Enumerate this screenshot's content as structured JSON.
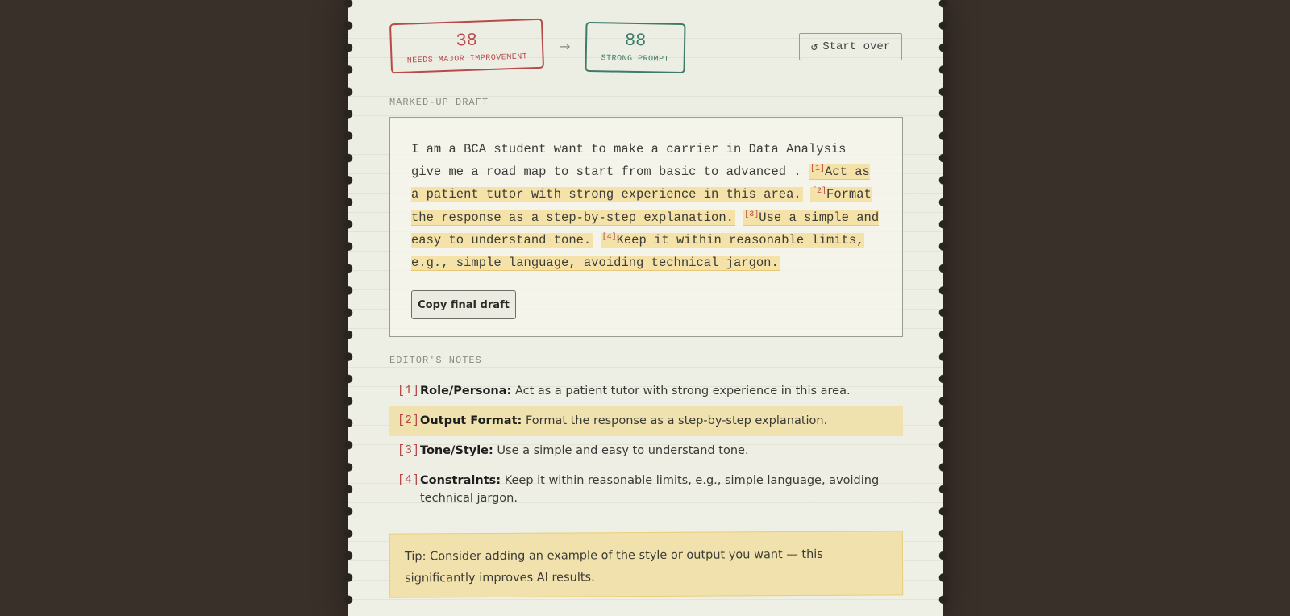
{
  "scores": {
    "before": {
      "value": "38",
      "label": "NEEDS MAJOR IMPROVEMENT"
    },
    "after": {
      "value": "88",
      "label": "STRONG PROMPT"
    },
    "arrow": "→"
  },
  "actions": {
    "start_over_icon": "↺",
    "start_over_label": "Start over",
    "copy_label": "Copy final draft"
  },
  "draft": {
    "section_label": "MARKED-UP DRAFT",
    "original_text": "I am a BCA student want to make a carrier in Data Analysis give me a road map to start from basic to advanced .",
    "additions": [
      {
        "marker": "[1]",
        "text": "Act as a patient tutor with strong experience in this area."
      },
      {
        "marker": "[2]",
        "text": "Format the response as a step-by-step explanation."
      },
      {
        "marker": "[3]",
        "text": "Use a simple and easy to understand tone."
      },
      {
        "marker": "[4]",
        "text": "Keep it within reasonable limits, e.g., simple language, avoiding technical jargon."
      }
    ]
  },
  "notes": {
    "section_label": "EDITOR'S NOTES",
    "items": [
      {
        "num": "[1]",
        "title": "Role/Persona:",
        "text": "Act as a patient tutor with strong experience in this area."
      },
      {
        "num": "[2]",
        "title": "Output Format:",
        "text": "Format the response as a step-by-step explanation."
      },
      {
        "num": "[3]",
        "title": "Tone/Style:",
        "text": "Use a simple and easy to understand tone."
      },
      {
        "num": "[4]",
        "title": "Constraints:",
        "text": "Keep it within reasonable limits, e.g., simple language, avoiding technical jargon."
      }
    ],
    "active_index": 1
  },
  "tip": "Tip: Consider adding an example of the style or output you want — this significantly improves AI results.",
  "colors": {
    "background": "#3a302a",
    "paper": "#ecede3",
    "stamp_before": "#b84a4a",
    "stamp_after": "#3e7b68",
    "highlight": "#f5e2a8",
    "tip_note": "#f1e2ad"
  }
}
